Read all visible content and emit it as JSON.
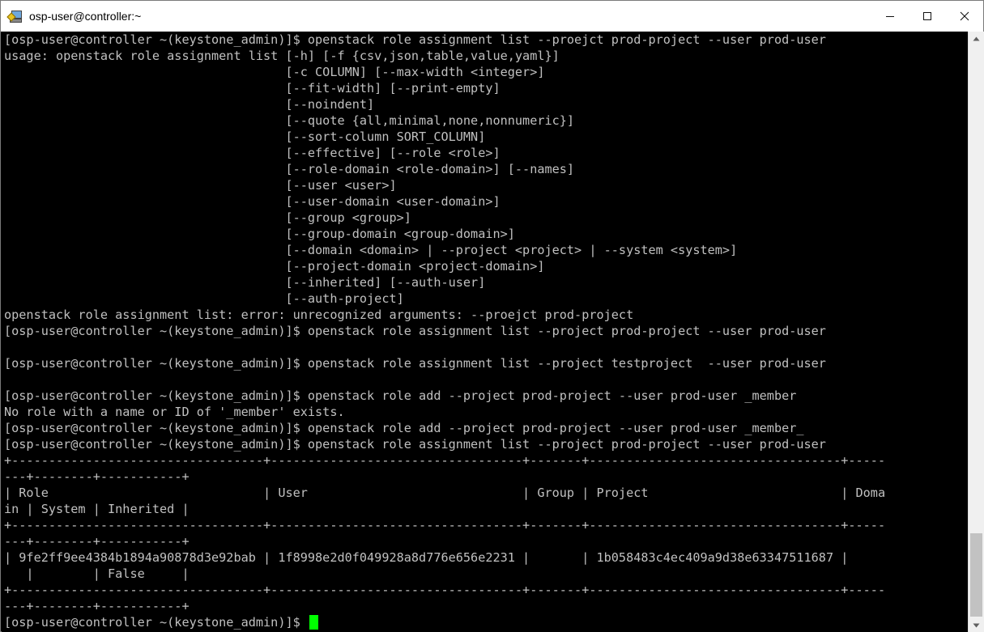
{
  "window": {
    "title": "osp-user@controller:~",
    "controls": {
      "minimize": "minimize-icon",
      "maximize": "maximize-icon",
      "close": "close-icon"
    }
  },
  "terminal": {
    "colors": {
      "background": "#000000",
      "text": "#c0c0c0",
      "cursor": "#00ff00"
    },
    "lines": [
      "[osp-user@controller ~(keystone_admin)]$ openstack role assignment list --proejct prod-project --user prod-user",
      "usage: openstack role assignment list [-h] [-f {csv,json,table,value,yaml}]",
      "                                      [-c COLUMN] [--max-width <integer>]",
      "                                      [--fit-width] [--print-empty]",
      "                                      [--noindent]",
      "                                      [--quote {all,minimal,none,nonnumeric}]",
      "                                      [--sort-column SORT_COLUMN]",
      "                                      [--effective] [--role <role>]",
      "                                      [--role-domain <role-domain>] [--names]",
      "                                      [--user <user>]",
      "                                      [--user-domain <user-domain>]",
      "                                      [--group <group>]",
      "                                      [--group-domain <group-domain>]",
      "                                      [--domain <domain> | --project <project> | --system <system>]",
      "                                      [--project-domain <project-domain>]",
      "                                      [--inherited] [--auth-user]",
      "                                      [--auth-project]",
      "openstack role assignment list: error: unrecognized arguments: --proejct prod-project",
      "[osp-user@controller ~(keystone_admin)]$ openstack role assignment list --project prod-project --user prod-user",
      "",
      "[osp-user@controller ~(keystone_admin)]$ openstack role assignment list --project testproject  --user prod-user",
      "",
      "[osp-user@controller ~(keystone_admin)]$ openstack role add --project prod-project --user prod-user _member",
      "No role with a name or ID of '_member' exists.",
      "[osp-user@controller ~(keystone_admin)]$ openstack role add --project prod-project --user prod-user _member_",
      "[osp-user@controller ~(keystone_admin)]$ openstack role assignment list --project prod-project --user prod-user",
      "+----------------------------------+----------------------------------+-------+----------------------------------+-----",
      "---+--------+-----------+",
      "| Role                             | User                             | Group | Project                          | Doma",
      "in | System | Inherited |",
      "+----------------------------------+----------------------------------+-------+----------------------------------+-----",
      "---+--------+-----------+",
      "| 9fe2ff9ee4384b1894a90878d3e92bab | 1f8998e2d0f049928a8d776e656e2231 |       | 1b058483c4ec409a9d38e63347511687 |",
      "   |        | False     |",
      "+----------------------------------+----------------------------------+-------+----------------------------------+-----",
      "---+--------+-----------+"
    ],
    "prompt": "[osp-user@controller ~(keystone_admin)]$ "
  }
}
